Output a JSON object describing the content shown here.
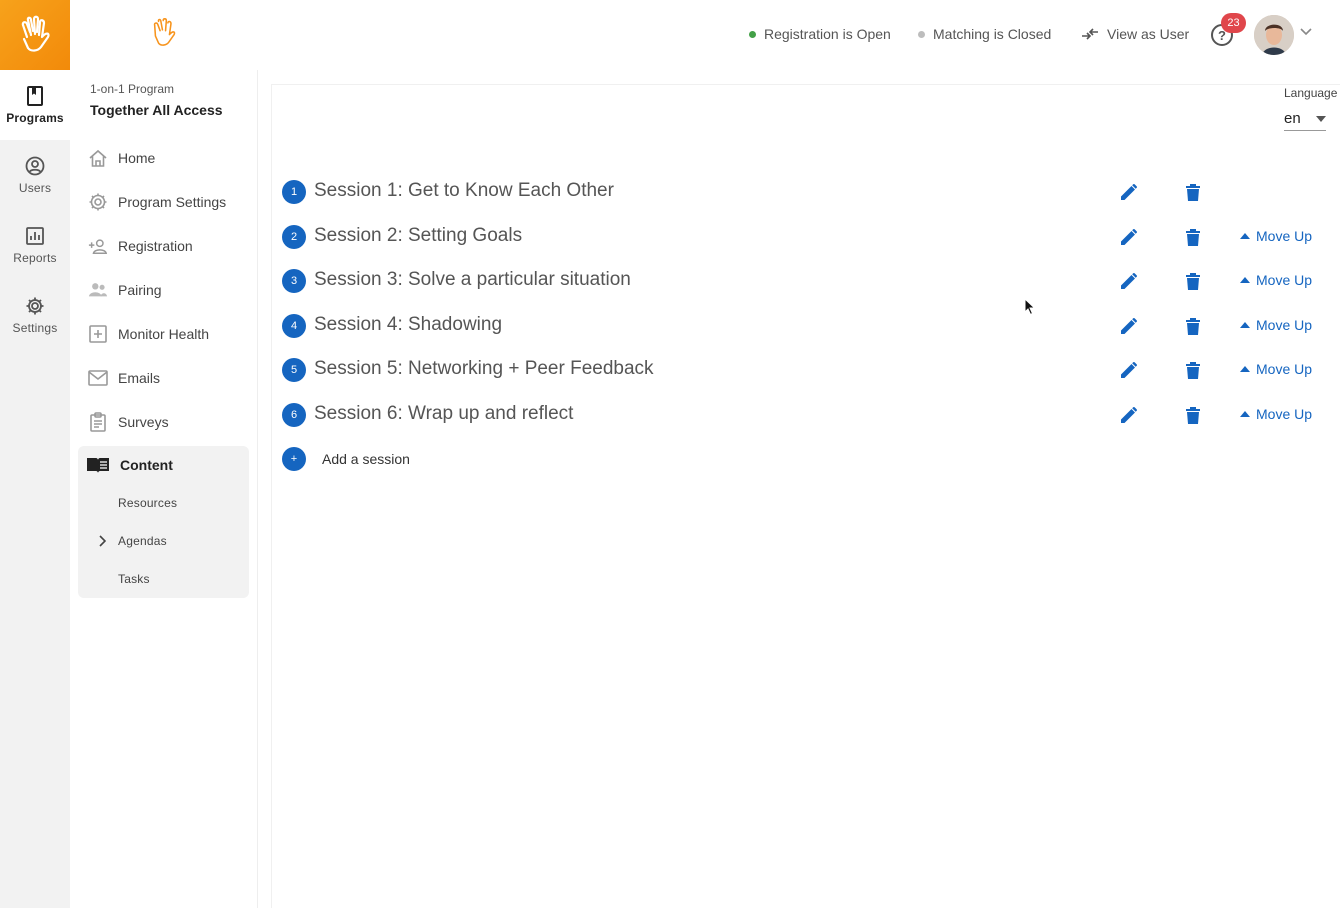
{
  "header": {
    "registration_status": "Registration is Open",
    "registration_color": "#43a047",
    "matching_status": "Matching is Closed",
    "matching_color": "#bdbdbd",
    "view_as_user": "View as User",
    "notification_count": "23"
  },
  "rail": {
    "brand_color": "#f7941d",
    "items": [
      {
        "label": "Programs",
        "icon": "bookmark-icon"
      },
      {
        "label": "Users",
        "icon": "user-circle-icon"
      },
      {
        "label": "Reports",
        "icon": "bar-chart-icon"
      },
      {
        "label": "Settings",
        "icon": "gear-icon"
      }
    ]
  },
  "sidebar": {
    "program_type": "1-on-1 Program",
    "program_name": "Together All Access",
    "items": [
      {
        "label": "Home",
        "icon": "home-icon"
      },
      {
        "label": "Program Settings",
        "icon": "gear-icon"
      },
      {
        "label": "Registration",
        "icon": "add-person-icon"
      },
      {
        "label": "Pairing",
        "icon": "people-icon"
      },
      {
        "label": "Monitor Health",
        "icon": "plus-box-icon"
      },
      {
        "label": "Emails",
        "icon": "envelope-icon"
      },
      {
        "label": "Surveys",
        "icon": "clipboard-icon"
      }
    ],
    "content": {
      "label": "Content",
      "icon": "open-book-icon",
      "sub_items": [
        {
          "label": "Resources"
        },
        {
          "label": "Agendas"
        },
        {
          "label": "Tasks"
        }
      ]
    }
  },
  "language": {
    "label": "Language",
    "value": "en"
  },
  "sessions": [
    {
      "number": "1",
      "title": "Session 1: Get to Know Each Other"
    },
    {
      "number": "2",
      "title": "Session 2: Setting Goals",
      "move_up": "Move Up"
    },
    {
      "number": "3",
      "title": "Session 3: Solve a particular situation",
      "move_up": "Move Up"
    },
    {
      "number": "4",
      "title": "Session 4: Shadowing",
      "move_up": "Move Up"
    },
    {
      "number": "5",
      "title": "Session 5: Networking + Peer Feedback",
      "move_up": "Move Up"
    },
    {
      "number": "6",
      "title": "Session 6: Wrap up and reflect",
      "move_up": "Move Up"
    }
  ],
  "add_session": {
    "icon_label": "+",
    "label": "Add a session"
  },
  "colors": {
    "accent_blue": "#1565c0"
  }
}
